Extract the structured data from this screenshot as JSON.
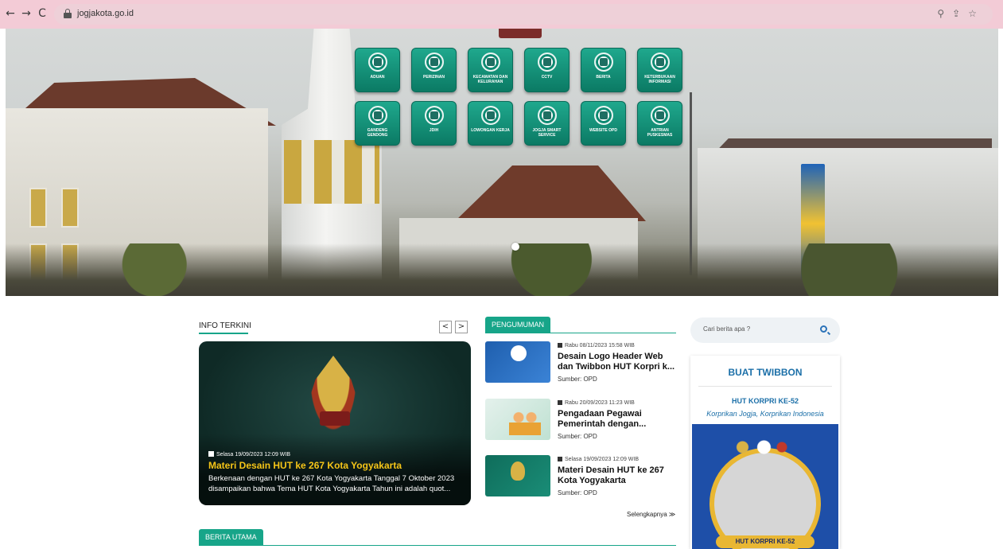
{
  "browser": {
    "url": "jogjakota.go.id",
    "icons": [
      "back-icon",
      "forward-icon",
      "reload-icon",
      "lock-icon",
      "zoom-icon",
      "share-icon",
      "star-icon"
    ]
  },
  "hero": {
    "services": [
      {
        "label": "ADUAN",
        "icon": "complaint-icon"
      },
      {
        "label": "PERIZINAN",
        "icon": "permit-icon"
      },
      {
        "label": "KECAMATAN DAN KELURAHAN",
        "icon": "district-icon"
      },
      {
        "label": "CCTV",
        "icon": "cctv-icon"
      },
      {
        "label": "BERITA",
        "icon": "news-icon"
      },
      {
        "label": "KETERBUKAAN INFORMASI",
        "icon": "info-icon"
      },
      {
        "label": "GANDENG GENDONG",
        "icon": "gandeng-icon"
      },
      {
        "label": "JDIH",
        "icon": "jdih-icon"
      },
      {
        "label": "LOWONGAN KERJA",
        "icon": "job-icon"
      },
      {
        "label": "JOGJA SMART SERVICE",
        "icon": "jss-icon"
      },
      {
        "label": "WEBSITE OPD",
        "icon": "website-icon"
      },
      {
        "label": "ANTRIAN PUSKESMAS",
        "icon": "queue-icon"
      }
    ]
  },
  "info_terkini": {
    "title": "INFO TERKINI",
    "prev": "<",
    "next": ">",
    "feature": {
      "date": "Selasa 19/09/2023 12:09 WIB",
      "headline": "Materi Desain HUT ke 267 Kota Yogyakarta",
      "summary": "Berkenaan dengan HUT ke 267 Kota Yogyakarta Tanggal 7 Oktober 2023 disampaikan bahwa Tema HUT Kota Yogyakarta Tahun ini adalah quot..."
    }
  },
  "pengumuman": {
    "title": "PENGUMUMAN",
    "items": [
      {
        "date": "Rabu 08/11/2023 15:58 WIB",
        "title": "Desain Logo Header Web dan Twibbon HUT Korpri k...",
        "source": "Sumber: OPD"
      },
      {
        "date": "Rabu 20/09/2023 11:23 WIB",
        "title": "Pengadaan Pegawai Pemerintah dengan...",
        "source": "Sumber: OPD"
      },
      {
        "date": "Selasa 19/09/2023 12:09 WIB",
        "title": "Materi Desain HUT ke 267 Kota Yogyakarta",
        "source": "Sumber: OPD"
      }
    ],
    "more": "Selengkapnya ≫"
  },
  "berita_utama": {
    "title": "BERITA UTAMA"
  },
  "search": {
    "placeholder": "Cari berita apa ?"
  },
  "twibbon": {
    "title": "BUAT TWIBBON",
    "subtitle": "HUT KORPRI KE-52",
    "tagline": "Korprikan Jogja, Korprikan Indonesia",
    "banner": "HUT KORPRI KE-52"
  }
}
